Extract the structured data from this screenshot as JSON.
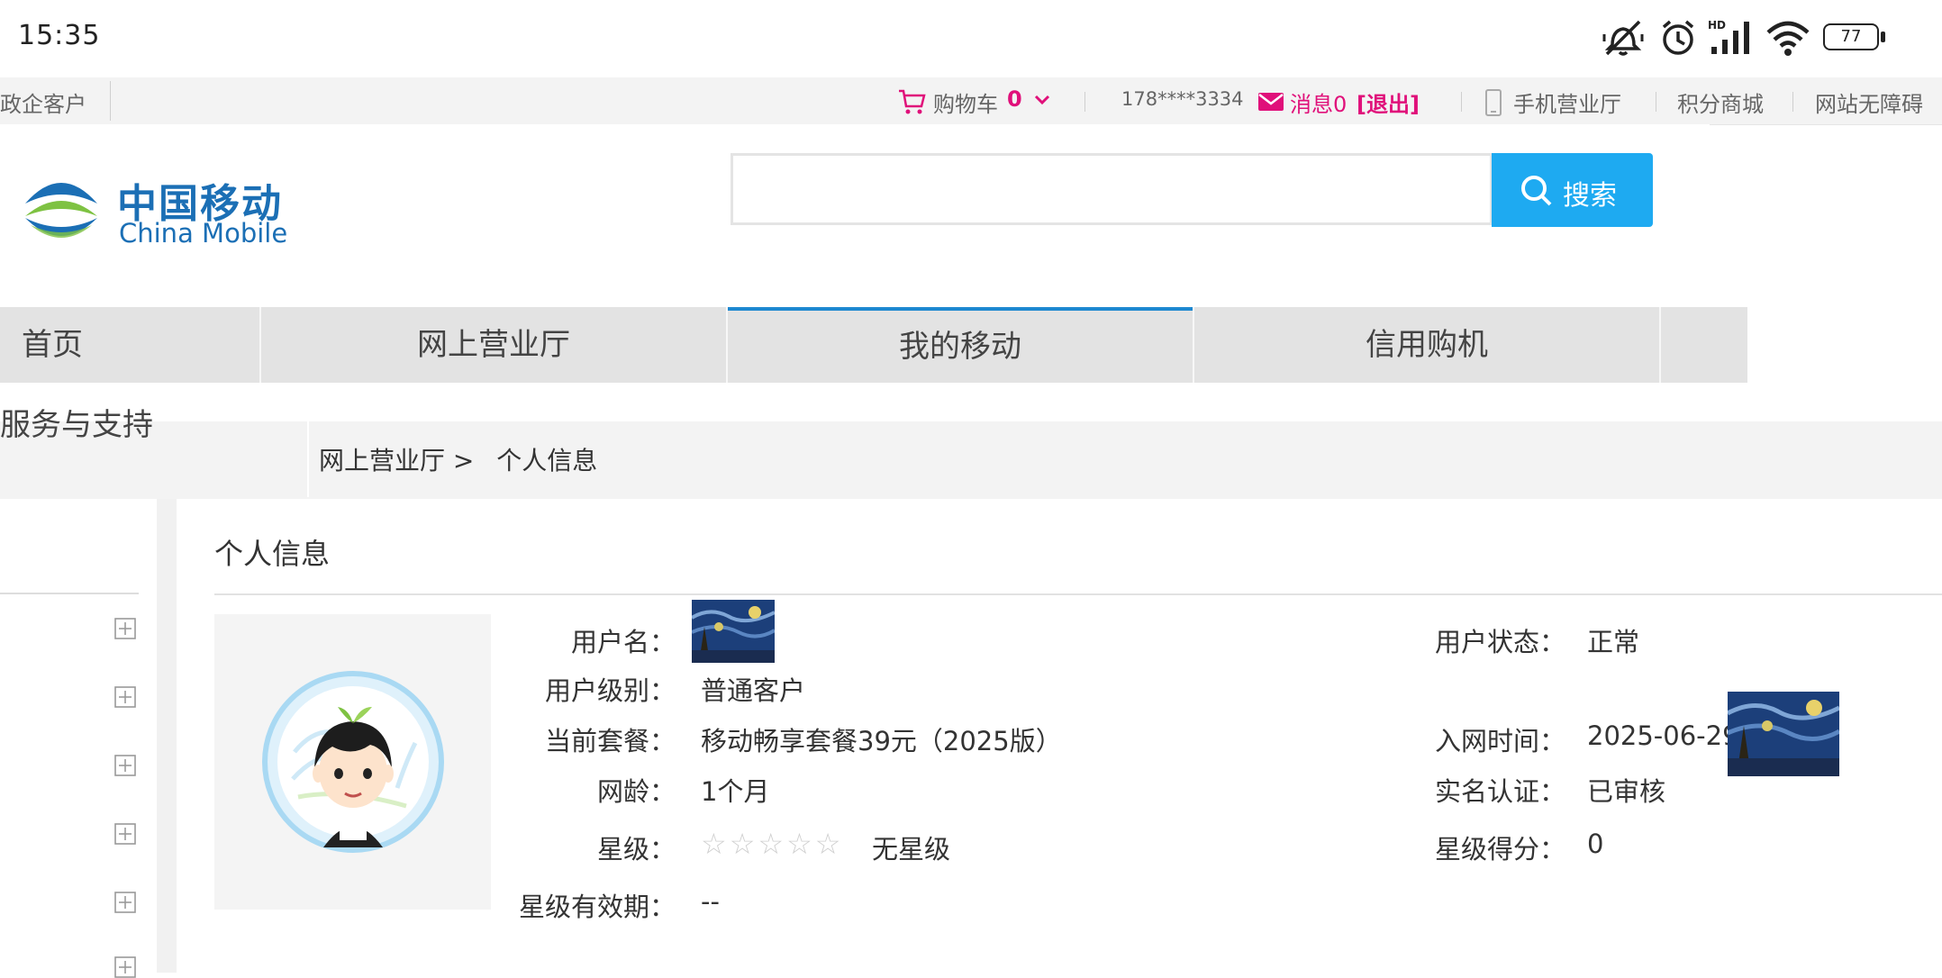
{
  "status_bar": {
    "time": "15:35",
    "battery": "77",
    "icons": [
      "mute-vibrate-icon",
      "alarm-icon",
      "hd-signal-icon",
      "wifi-icon",
      "battery-icon"
    ]
  },
  "top_bar": {
    "left_link": "政企客户",
    "cart_label": "购物车",
    "cart_count": "0",
    "phone_masked": "178****3334",
    "messages_label": "消息0",
    "logout_label": "[退出]",
    "mobile_hall": "手机营业厅",
    "points_mall": "积分商城",
    "accessibility": "网站无障碍"
  },
  "logo": {
    "cn": "中国移动",
    "en": "China Mobile"
  },
  "search": {
    "placeholder": "",
    "button_label": "搜索"
  },
  "nav": {
    "tabs": [
      {
        "label": "首页"
      },
      {
        "label": "网上营业厅"
      },
      {
        "label": "我的移动",
        "active": true
      },
      {
        "label": "信用购机"
      }
    ],
    "overflow_label": "服务与支持"
  },
  "breadcrumb": {
    "parent": "网上营业厅 >",
    "current": "个人信息"
  },
  "panel": {
    "title": "个人信息",
    "fields": {
      "username_label": "用户名：",
      "level_label": "用户级别：",
      "level_value": "普通客户",
      "plan_label": "当前套餐：",
      "plan_value": "移动畅享套餐39元（2025版）",
      "age_label": "网龄：",
      "age_value": "1个月",
      "star_label": "星级：",
      "star_value": "无星级",
      "star_count": 0,
      "star_max": 5,
      "star_valid_label": "星级有效期：",
      "star_valid_value": "--",
      "status_label": "用户状态：",
      "status_value": "正常",
      "join_label": "入网时间：",
      "join_value": "2025-06-29",
      "realname_label": "实名认证：",
      "realname_value": "已审核",
      "star_score_label": "星级得分：",
      "star_score_value": "0"
    }
  },
  "colors": {
    "accent_blue": "#1eaaf1",
    "nav_active_line": "#1e88d0",
    "message_magenta": "#e0107a",
    "logo_blue": "#1b6fb5",
    "logo_green": "#7ec242"
  }
}
